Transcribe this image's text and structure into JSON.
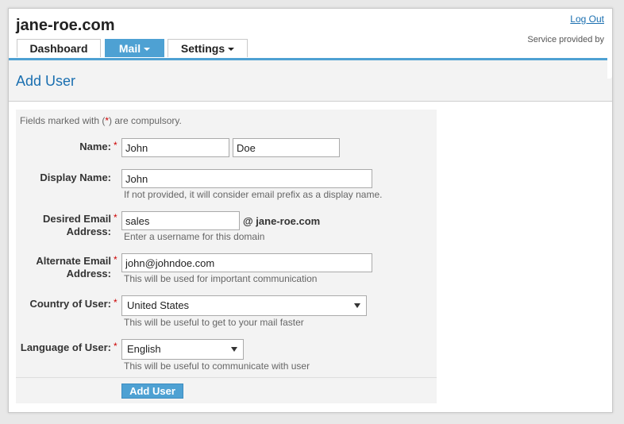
{
  "header": {
    "domain": "jane-roe.com",
    "logout_label": "Log Out",
    "provided_by": "Service provided by"
  },
  "tabs": [
    {
      "label": "Dashboard",
      "active": false,
      "has_dropdown": false
    },
    {
      "label": "Mail",
      "active": true,
      "has_dropdown": true
    },
    {
      "label": "Settings",
      "active": false,
      "has_dropdown": true
    }
  ],
  "page": {
    "title": "Add User"
  },
  "form": {
    "note_prefix": "Fields marked with (",
    "note_star": "*",
    "note_suffix": ") are compulsory.",
    "required_marker": "*",
    "name": {
      "label": "Name:",
      "first_value": "John",
      "last_value": "Doe"
    },
    "display_name": {
      "label": "Display Name:",
      "value": "John",
      "hint": "If not provided, it will consider email prefix as a display name."
    },
    "desired_email": {
      "label_line1": "Desired Email",
      "label_line2": "Address:",
      "value": "sales",
      "domain_suffix": "@ jane-roe.com",
      "hint": "Enter a username for this domain"
    },
    "alternate_email": {
      "label_line1": "Alternate Email",
      "label_line2": "Address:",
      "value": "john@johndoe.com",
      "hint": "This will be used for important communication"
    },
    "country": {
      "label": "Country of User:",
      "selected": "United States",
      "hint": "This will be useful to get to your mail faster"
    },
    "language": {
      "label": "Language of User:",
      "selected": "English",
      "hint": "This will be useful to communicate with user"
    },
    "submit_label": "Add User"
  },
  "colors": {
    "accent": "#4ea1d3",
    "link": "#1a6fb0",
    "required": "#cc0000",
    "panel": "#f3f3f3"
  }
}
